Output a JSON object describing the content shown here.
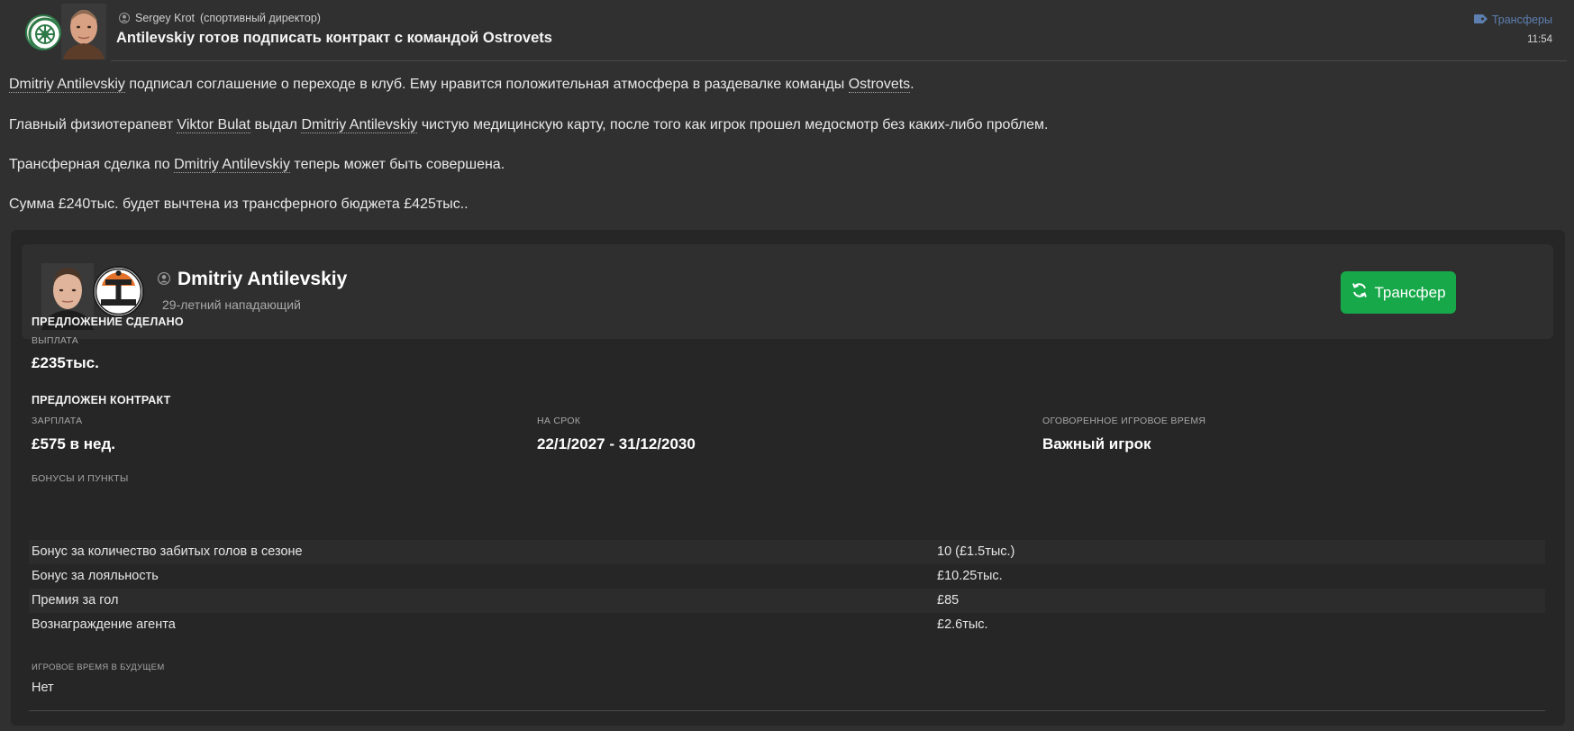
{
  "header": {
    "sender_name": "Sergey Krot",
    "sender_role": "(спортивный директор)",
    "subject": "Antilevskiy готов подписать контракт с командой Ostrovets",
    "category": "Трансферы",
    "time": "11:54"
  },
  "body": {
    "p1": {
      "player": "Dmitriy Antilevskiy",
      "mid": " подписал соглашение о переходе в клуб. Ему нравится положительная атмосфера в раздевалке команды ",
      "club": "Ostrovets",
      "end": "."
    },
    "p2": {
      "start": "Главный физиотерапевт ",
      "physio": "Viktor Bulat",
      "mid": " выдал ",
      "player": "Dmitriy Antilevskiy",
      "end": " чистую медицинскую карту, после того как игрок прошел медосмотр без каких-либо проблем."
    },
    "p3": {
      "start": "Трансферная сделка по ",
      "player": "Dmitriy Antilevskiy",
      "end": " теперь может быть совершена."
    },
    "p4": "Сумма £240тыс. будет вычтена из трансферного бюджета £425тыс.."
  },
  "player": {
    "name": "Dmitriy Antilevskiy",
    "description": "29-летний нападающий",
    "action_button": "Трансфер"
  },
  "offer": {
    "title": "ПРЕДЛОЖЕНИЕ СДЕЛАНО",
    "fee_label": "ВЫПЛАТА",
    "fee_value": "£235тыс."
  },
  "contract": {
    "title": "ПРЕДЛОЖЕН КОНТРАКТ",
    "wage_label": "ЗАРПЛАТА",
    "wage_value": "£575 в нед.",
    "term_label": "НА СРОК",
    "term_value": "22/1/2027 - 31/12/2030",
    "playtime_label": "ОГОВОРЕННОЕ ИГРОВОЕ ВРЕМЯ",
    "playtime_value": "Важный игрок",
    "bonuses_label": "БОНУСЫ И ПУНКТЫ",
    "bonuses": [
      {
        "name": "Бонус за количество забитых голов в сезоне",
        "value": "10 (£1.5тыс.)"
      },
      {
        "name": "Бонус за лояльность",
        "value": "£10.25тыс."
      },
      {
        "name": "Премия за гол",
        "value": "£85"
      },
      {
        "name": "Вознаграждение агента",
        "value": "£2.6тыс."
      }
    ],
    "future_label": "ИГРОВОЕ ВРЕМЯ В БУДУЩЕМ",
    "future_value": "Нет"
  },
  "colors": {
    "background": "#303030",
    "card": "#262626",
    "panel": "#2f2f2f",
    "accent_green": "#17a84a",
    "category_blue": "#5d7fb0"
  }
}
